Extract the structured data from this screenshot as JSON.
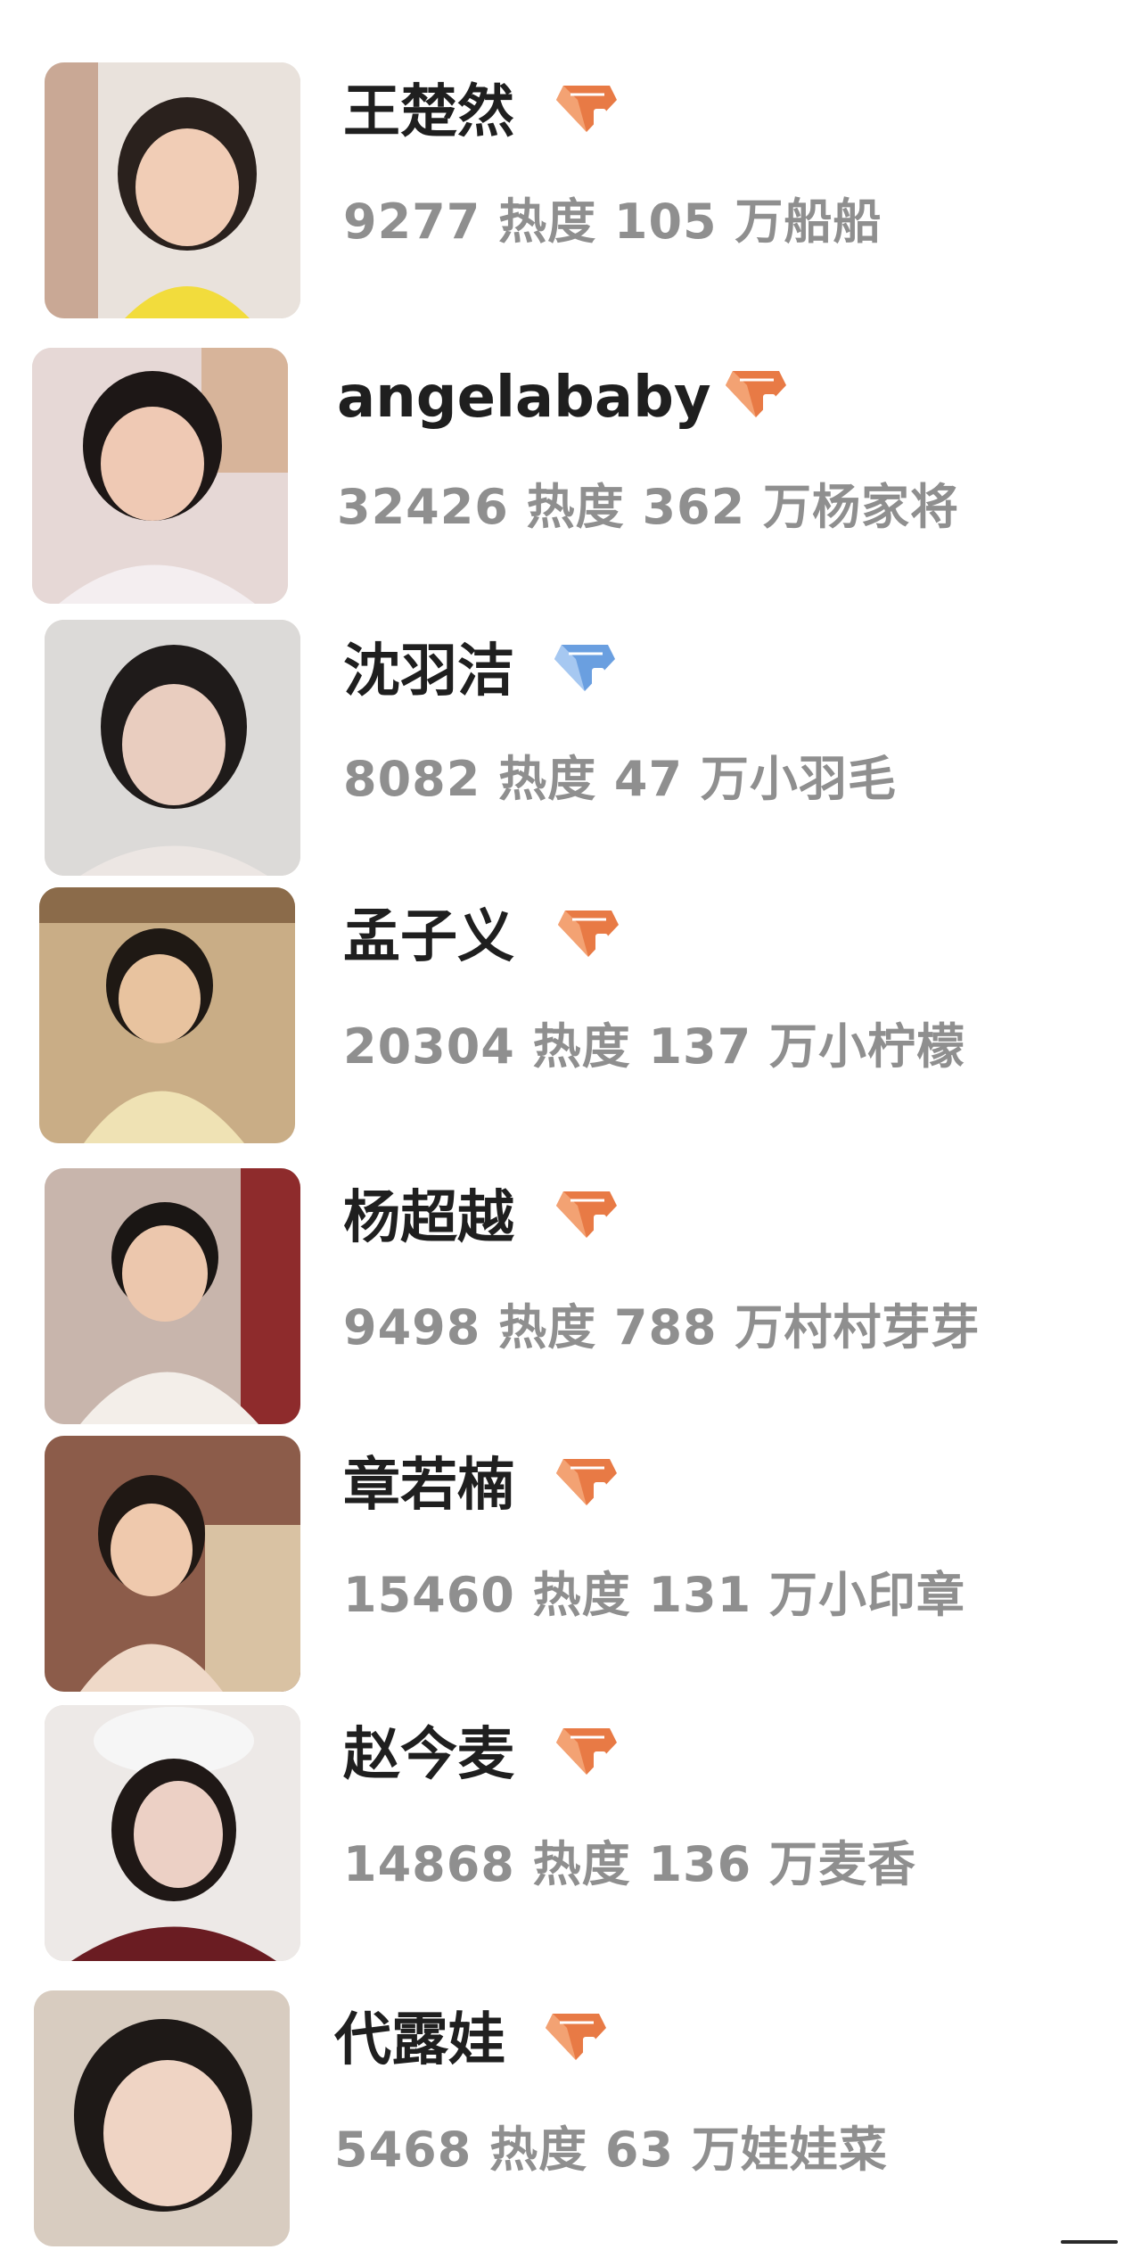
{
  "colors": {
    "name_text": "#1f1f1f",
    "stats_text": "#8f8f8f",
    "badge_orange": "#e87a45",
    "badge_blue": "#6a9fe0",
    "background": "#ffffff"
  },
  "users": [
    {
      "name": "王楚然",
      "stats": "9277 热度 105 万船船",
      "badge": "orange-diamond-icon"
    },
    {
      "name": "angelababy",
      "stats": "32426 热度 362 万杨家将",
      "badge": "orange-diamond-icon"
    },
    {
      "name": "沈羽洁",
      "stats": "8082 热度 47 万小羽毛",
      "badge": "blue-diamond-icon"
    },
    {
      "name": "孟子义",
      "stats": "20304 热度 137 万小柠檬",
      "badge": "orange-diamond-icon"
    },
    {
      "name": "杨超越",
      "stats": "9498 热度 788 万村村芽芽",
      "badge": "orange-diamond-icon"
    },
    {
      "name": "章若楠",
      "stats": "15460 热度 131 万小印章",
      "badge": "orange-diamond-icon"
    },
    {
      "name": "赵今麦",
      "stats": "14868 热度 136 万麦香",
      "badge": "orange-diamond-icon"
    },
    {
      "name": "代露娃",
      "stats": "5468 热度 63 万娃娃菜",
      "badge": "orange-diamond-icon"
    }
  ]
}
